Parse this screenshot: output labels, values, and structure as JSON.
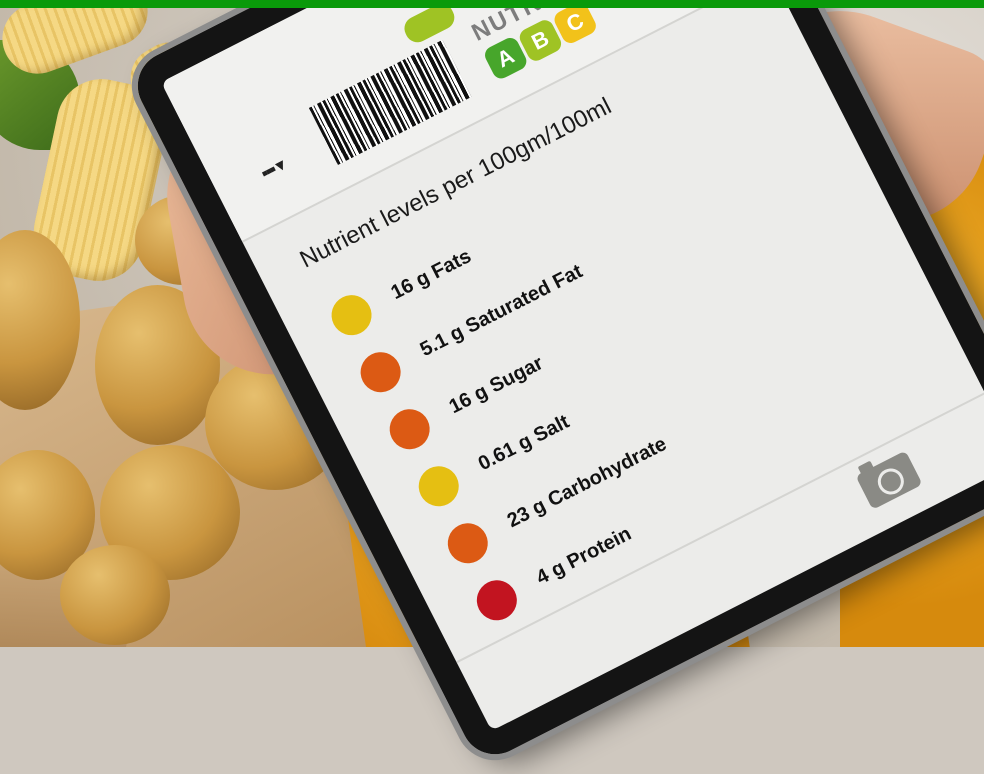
{
  "colors": {
    "accent_bar": "#0a9a0a",
    "dot_yellow": "#e5bf12",
    "dot_orange": "#dc5a14",
    "dot_red": "#c21420",
    "grade_a": "#47a62b",
    "grade_b": "#9fc324",
    "grade_c": "#f2c21a"
  },
  "screen": {
    "signal_icon": "▪▪▪ ▾",
    "nutri_title": "NUTRI",
    "grades": [
      "A",
      "B",
      "C"
    ],
    "heading": "Nutrient levels per 100gm/100ml",
    "nutrients": [
      {
        "label": "16 g Fats",
        "level": "yellow"
      },
      {
        "label": "5.1 g Saturated Fat",
        "level": "orange"
      },
      {
        "label": "16 g Sugar",
        "level": "orange"
      },
      {
        "label": "0.61 g Salt",
        "level": "yellow"
      },
      {
        "label": "23 g Carbohydrate",
        "level": "orange"
      },
      {
        "label": "4 g Protein",
        "level": "red"
      }
    ],
    "camera_icon": "camera-icon"
  }
}
